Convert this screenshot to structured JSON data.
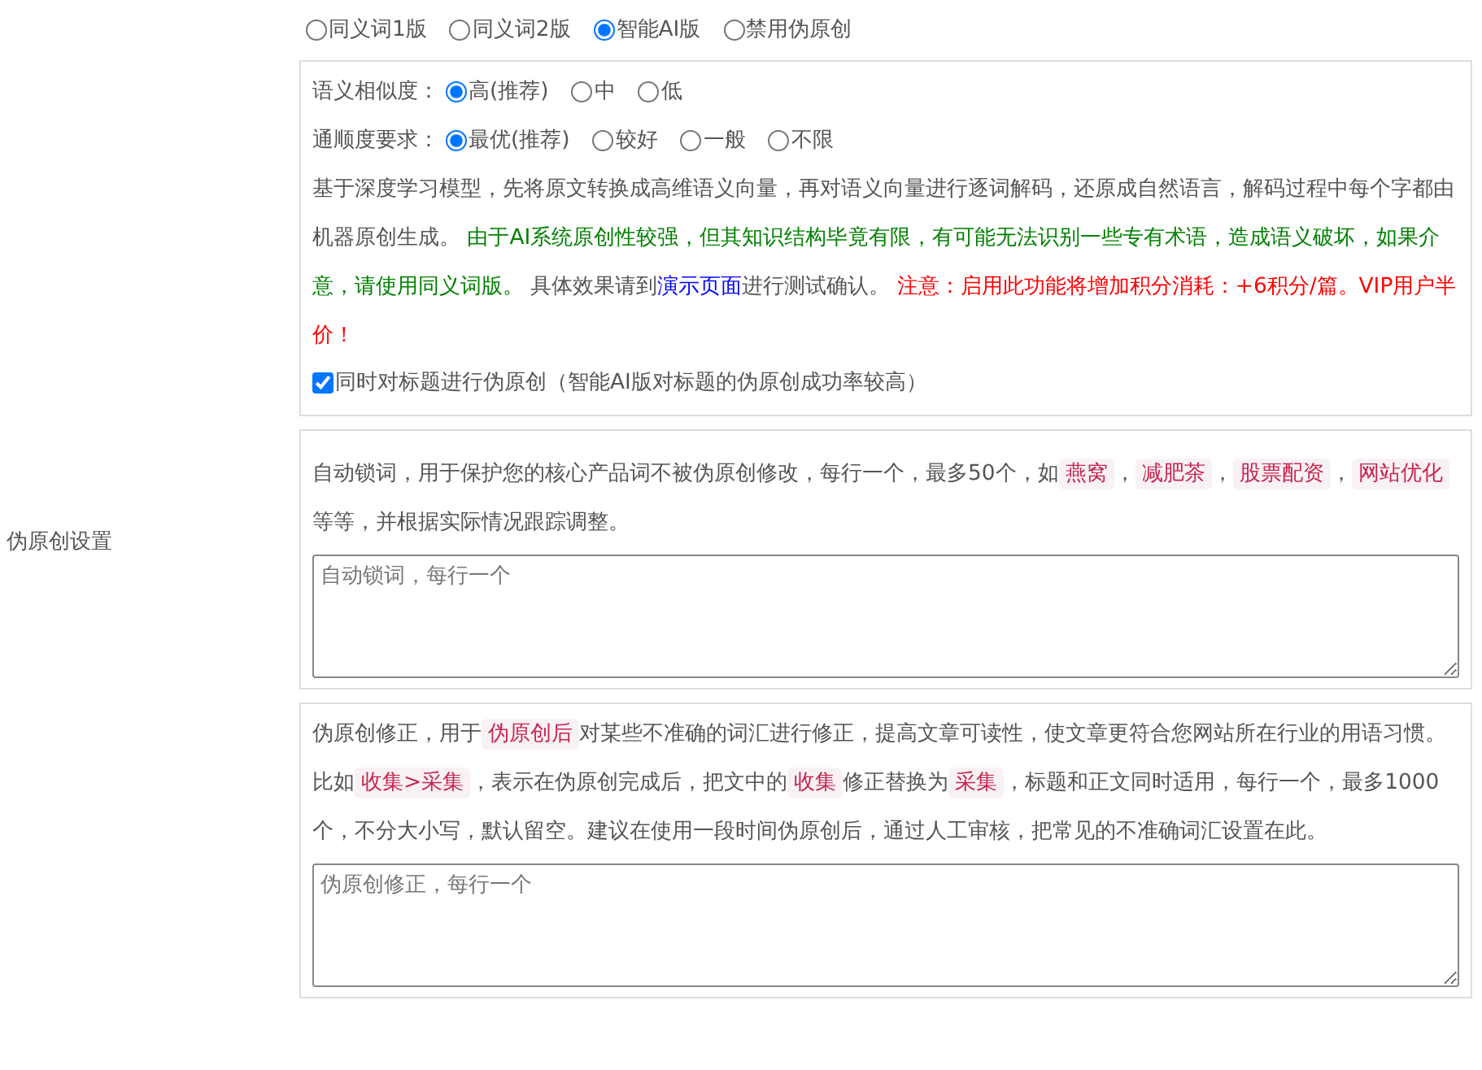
{
  "section_label": "伪原创设置",
  "mode_options": [
    {
      "label": "同义词1版",
      "selected": false
    },
    {
      "label": "同义词2版",
      "selected": false
    },
    {
      "label": "智能AI版",
      "selected": true
    },
    {
      "label": "禁用伪原创",
      "selected": false
    }
  ],
  "ai_panel": {
    "settings": [
      {
        "label": "语义相似度：",
        "options": [
          {
            "label": "高(推荐)",
            "selected": true
          },
          {
            "label": "中",
            "selected": false
          },
          {
            "label": "低",
            "selected": false
          }
        ]
      },
      {
        "label": "通顺度要求：",
        "options": [
          {
            "label": "最优(推荐)",
            "selected": true
          },
          {
            "label": "较好",
            "selected": false
          },
          {
            "label": "一般",
            "selected": false
          },
          {
            "label": "不限",
            "selected": false
          }
        ]
      }
    ],
    "description": [
      {
        "kind": "plain",
        "text": "基于深度学习模型，先将原文转换成高维语义向量，再对语义向量进行逐词解码，还原成自然语言，解码过程中每个字都由机器原创生成。 "
      },
      {
        "kind": "note",
        "text": "由于AI系统原创性较强，但其知识结构毕竟有限，有可能无法识别一些专有术语，造成语义破坏，如果介意，请使用同义词版。"
      },
      {
        "kind": "plain",
        "text": " 具体效果请到"
      },
      {
        "kind": "link",
        "text": "演示页面"
      },
      {
        "kind": "plain",
        "text": "进行测试确认。 "
      },
      {
        "kind": "warning",
        "text": "注意：启用此功能将增加积分消耗：+6积分/篇。VIP用户半价！"
      }
    ],
    "title_option": {
      "label": "同时对标题进行伪原创（智能AI版对标题的伪原创成功率较高）",
      "checked": true
    }
  },
  "lock_words": {
    "description": [
      {
        "kind": "plain",
        "text": "自动锁词，用于保护您的核心产品词不被伪原创修改，每行一个，最多50个，如"
      },
      {
        "kind": "code",
        "text": "燕窝"
      },
      {
        "kind": "plain",
        "text": "，"
      },
      {
        "kind": "code",
        "text": "减肥茶"
      },
      {
        "kind": "plain",
        "text": "，"
      },
      {
        "kind": "code",
        "text": "股票配资"
      },
      {
        "kind": "plain",
        "text": "，"
      },
      {
        "kind": "code",
        "text": "网站优化"
      },
      {
        "kind": "plain",
        "text": " 等等，并根据实际情况跟踪调整。"
      }
    ],
    "placeholder": "自动锁词，每行一个"
  },
  "corrections": {
    "description": [
      {
        "kind": "plain",
        "text": "伪原创修正，用于"
      },
      {
        "kind": "code",
        "text": "伪原创后"
      },
      {
        "kind": "plain",
        "text": "对某些不准确的词汇进行修正，提高文章可读性，使文章更符合您网站所在行业的用语习惯。比如"
      },
      {
        "kind": "code",
        "text": "收集>采集"
      },
      {
        "kind": "plain",
        "text": "，表示在伪原创完成后，把文中的"
      },
      {
        "kind": "code",
        "text": "收集"
      },
      {
        "kind": "plain",
        "text": "修正替换为"
      },
      {
        "kind": "code",
        "text": "采集"
      },
      {
        "kind": "plain",
        "text": "，标题和正文同时适用，每行一个，最多1000个，不分大小写，默认留空。建议在使用一段时间伪原创后，通过人工审核，把常见的不准确词汇设置在此。"
      }
    ],
    "placeholder": "伪原创修正，每行一个"
  }
}
